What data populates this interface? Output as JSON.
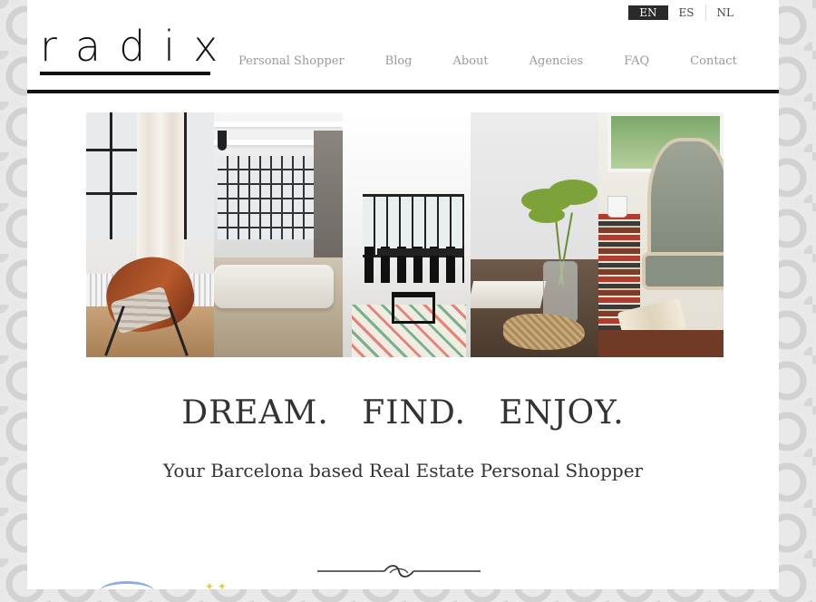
{
  "brand": {
    "logo_text": "radix"
  },
  "languages": [
    {
      "code": "EN",
      "active": true
    },
    {
      "code": "ES",
      "active": false
    },
    {
      "code": "NL",
      "active": false
    }
  ],
  "nav": {
    "items": [
      {
        "label": "Personal Shopper"
      },
      {
        "label": "Blog"
      },
      {
        "label": "About"
      },
      {
        "label": "Agencies"
      },
      {
        "label": "FAQ"
      },
      {
        "label": "Contact"
      }
    ]
  },
  "hero": {
    "panels": [
      "loft-window-butterfly-chair",
      "industrial-loft-sofa",
      "dining-room-rug",
      "plant-still-life",
      "armchair-books"
    ]
  },
  "tagline": "DREAM. FIND. ENJOY.",
  "subtitle": "Your Barcelona based Real Estate Personal Shopper",
  "colors": {
    "header_rule": "#111111",
    "lang_active_bg": "#2a2a2a",
    "nav_text": "#9a9a9a",
    "body_text": "#333333"
  }
}
